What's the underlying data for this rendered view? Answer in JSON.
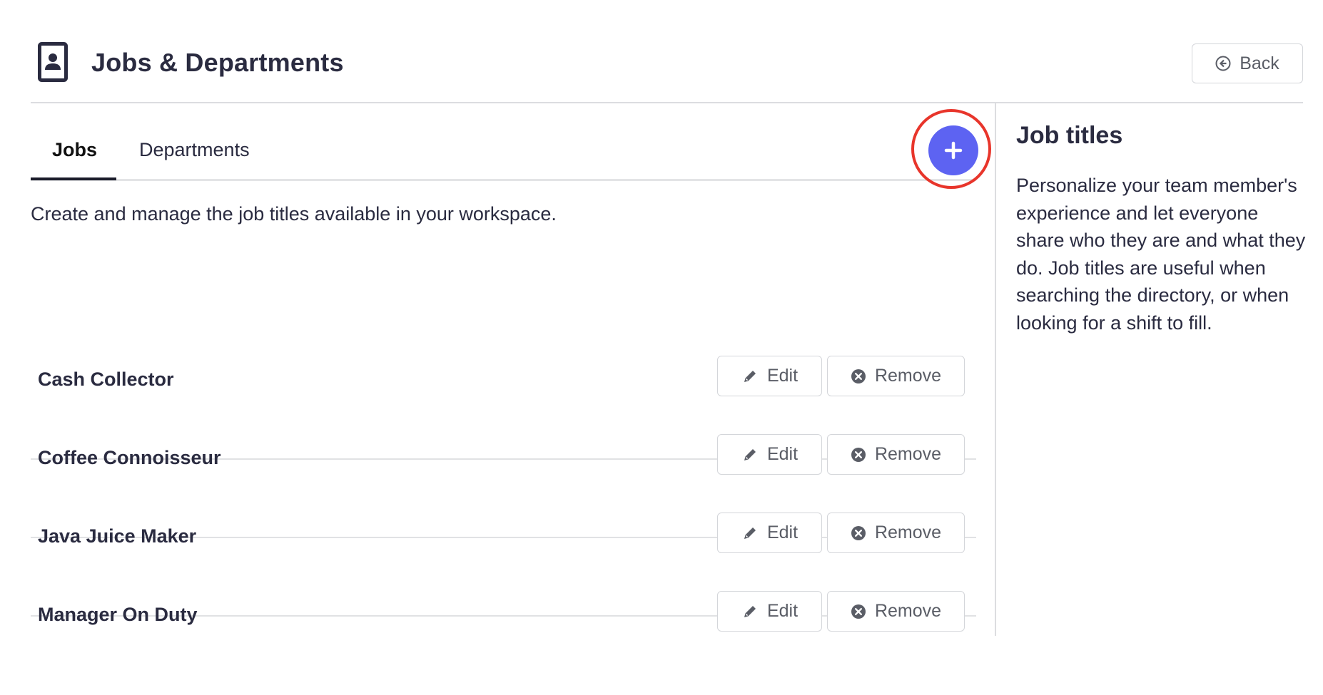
{
  "header": {
    "title": "Jobs & Departments",
    "back_label": "Back"
  },
  "tabs": [
    {
      "label": "Jobs",
      "active": true
    },
    {
      "label": "Departments",
      "active": false
    }
  ],
  "description": "Create and manage the job titles available in your workspace.",
  "jobs": [
    {
      "name": "Cash Collector"
    },
    {
      "name": "Coffee Connoisseur"
    },
    {
      "name": "Java Juice Maker"
    },
    {
      "name": "Manager On Duty"
    }
  ],
  "row_actions": {
    "edit_label": "Edit",
    "remove_label": "Remove"
  },
  "sidebar": {
    "title": "Job titles",
    "body": "Personalize your team member's experience and let everyone share who they are and what they do. Job titles are useful when searching the directory, or when looking for a shift to fill."
  },
  "icons": {
    "page": "contact-card-icon",
    "back": "arrow-left-circle-icon",
    "add": "plus-icon",
    "edit": "pencil-icon",
    "remove": "x-circle-icon"
  },
  "colors": {
    "accent": "#5d63f2",
    "highlight": "#e8352b",
    "text": "#2a2b40",
    "muted": "#5a5d66"
  }
}
